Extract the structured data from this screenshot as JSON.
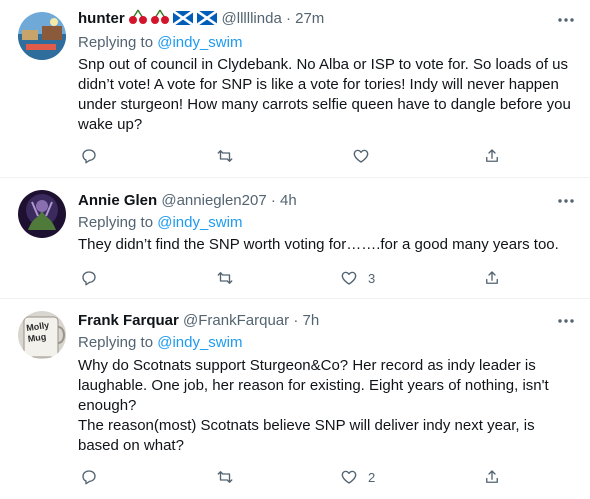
{
  "tweets": [
    {
      "name": "hunter",
      "handle": "@lllllinda",
      "sep": "·",
      "time": "27m",
      "replying_prefix": "Replying to ",
      "replying_handle": "@indy_swim",
      "text": "Snp out of council in Clydebank. No Alba or ISP to vote for. So loads of us didn’t vote! A vote for SNP is like a vote for tories! Indy will never happen under sturgeon! How many carrots selfie queen have to dangle before you wake up?",
      "name_emojis": [
        "cherries",
        "cherries",
        "scotland-flag",
        "scotland-flag"
      ],
      "like_count": ""
    },
    {
      "name": "Annie Glen",
      "handle": "@annieglen207",
      "sep": "·",
      "time": "4h",
      "replying_prefix": "Replying to ",
      "replying_handle": "@indy_swim",
      "text": "They didn’t find the SNP worth voting for…….for a good many years too.",
      "like_count": "3"
    },
    {
      "name": "Frank Farquar",
      "handle": "@FrankFarquar",
      "sep": "·",
      "time": "7h",
      "replying_prefix": "Replying to ",
      "replying_handle": "@indy_swim",
      "text_lines": [
        "Why do Scotnats support Sturgeon&Co? Her record as indy leader is laughable. One job, her reason for existing. Eight years of nothing, isn't enough?",
        "The reason(most) Scotnats believe SNP will deliver indy next year, is based on what?"
      ],
      "like_count": "2",
      "avatar_text": "Molly Mug"
    }
  ],
  "colors": {
    "link": "#1d9bf0",
    "secondary": "#536471",
    "text": "#0f1419"
  }
}
